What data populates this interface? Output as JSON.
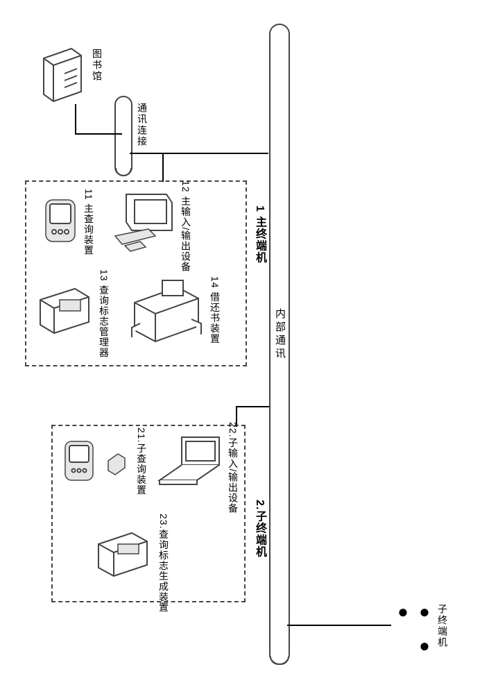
{
  "library": {
    "label": "图书馆",
    "icon": "server-icon"
  },
  "links": {
    "external": "通讯连接",
    "internal": "内部通讯"
  },
  "main_terminal": {
    "title": "1 主终端机",
    "components": {
      "c11": "11 主查询装置",
      "c12": "12 主输入/输出设备",
      "c13": "13 查询标志管理器",
      "c14": "14 借还书装置"
    }
  },
  "sub_terminal": {
    "title": "2.子终端机",
    "components": {
      "c21": "21.子查询装置",
      "c22": "22.子输入/输出设备",
      "c23": "23.查询标志生成装置"
    },
    "more_label": "子终端机",
    "ellipsis": "● ● ●"
  }
}
